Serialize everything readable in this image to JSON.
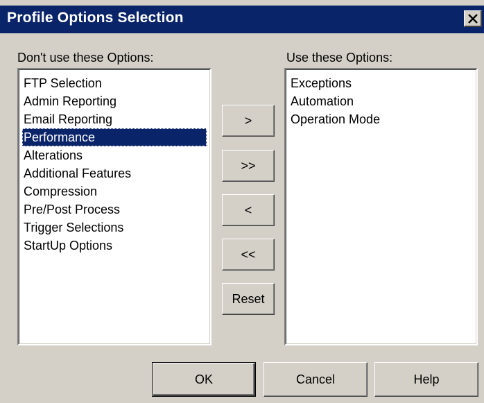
{
  "window": {
    "title": "Profile Options Selection",
    "close_icon": "close-x-icon"
  },
  "left_panel": {
    "label": "Don't use these Options:",
    "items": [
      "FTP Selection",
      "Admin Reporting",
      "Email Reporting",
      "Performance",
      "Alterations",
      "Additional Features",
      "Compression",
      "Pre/Post Process",
      "Trigger Selections",
      "StartUp Options"
    ],
    "selected": "Performance"
  },
  "right_panel": {
    "label": "Use these Options:",
    "items": [
      "Exceptions",
      "Automation",
      "Operation Mode"
    ]
  },
  "move_buttons": {
    "add": ">",
    "add_all": ">>",
    "remove": "<",
    "remove_all": "<<",
    "reset": "Reset"
  },
  "footer": {
    "ok": "OK",
    "cancel": "Cancel",
    "help": "Help"
  },
  "colors": {
    "title_bar": "#0a246a",
    "selection": "#0a246a",
    "face": "#d4d0c8"
  }
}
